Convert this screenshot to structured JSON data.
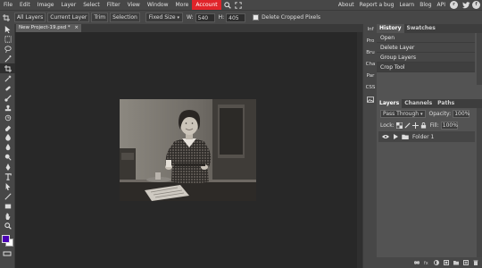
{
  "menu": {
    "items": [
      "File",
      "Edit",
      "Image",
      "Layer",
      "Select",
      "Filter",
      "View",
      "Window",
      "More"
    ],
    "account_label": "Account",
    "right_links": [
      "About",
      "Report a bug",
      "Learn",
      "Blog",
      "API"
    ]
  },
  "options": {
    "buttons": [
      "All Layers",
      "Current Layer",
      "Trim",
      "Selection"
    ],
    "size_mode": "Fixed Size",
    "width_label": "W:",
    "width_value": "540",
    "height_label": "H:",
    "height_value": "405",
    "delete_cropped_label": "Delete Cropped Pixels"
  },
  "document": {
    "tab_title": "New Project-19.psd *",
    "close_glyph": "×"
  },
  "mini_panels": [
    "Inf",
    "Pro",
    "Bru",
    "Cha",
    "Par",
    "CSS"
  ],
  "history_panel": {
    "tabs": [
      "History",
      "Swatches"
    ],
    "items": [
      "Open",
      "Delete Layer",
      "Group Layers",
      "Crop Tool"
    ]
  },
  "layers_panel": {
    "tabs": [
      "Layers",
      "Channels",
      "Paths"
    ],
    "blend_mode": "Pass Through",
    "opacity_label": "Opacity:",
    "opacity_value": "100%",
    "lock_label": "Lock:",
    "fill_label": "Fill:",
    "fill_value": "100%",
    "layers": [
      {
        "name": "Folder 1"
      }
    ]
  },
  "colors": {
    "foreground": "#4a00b4",
    "background": "#ffffff",
    "accent": "#e0242a"
  }
}
